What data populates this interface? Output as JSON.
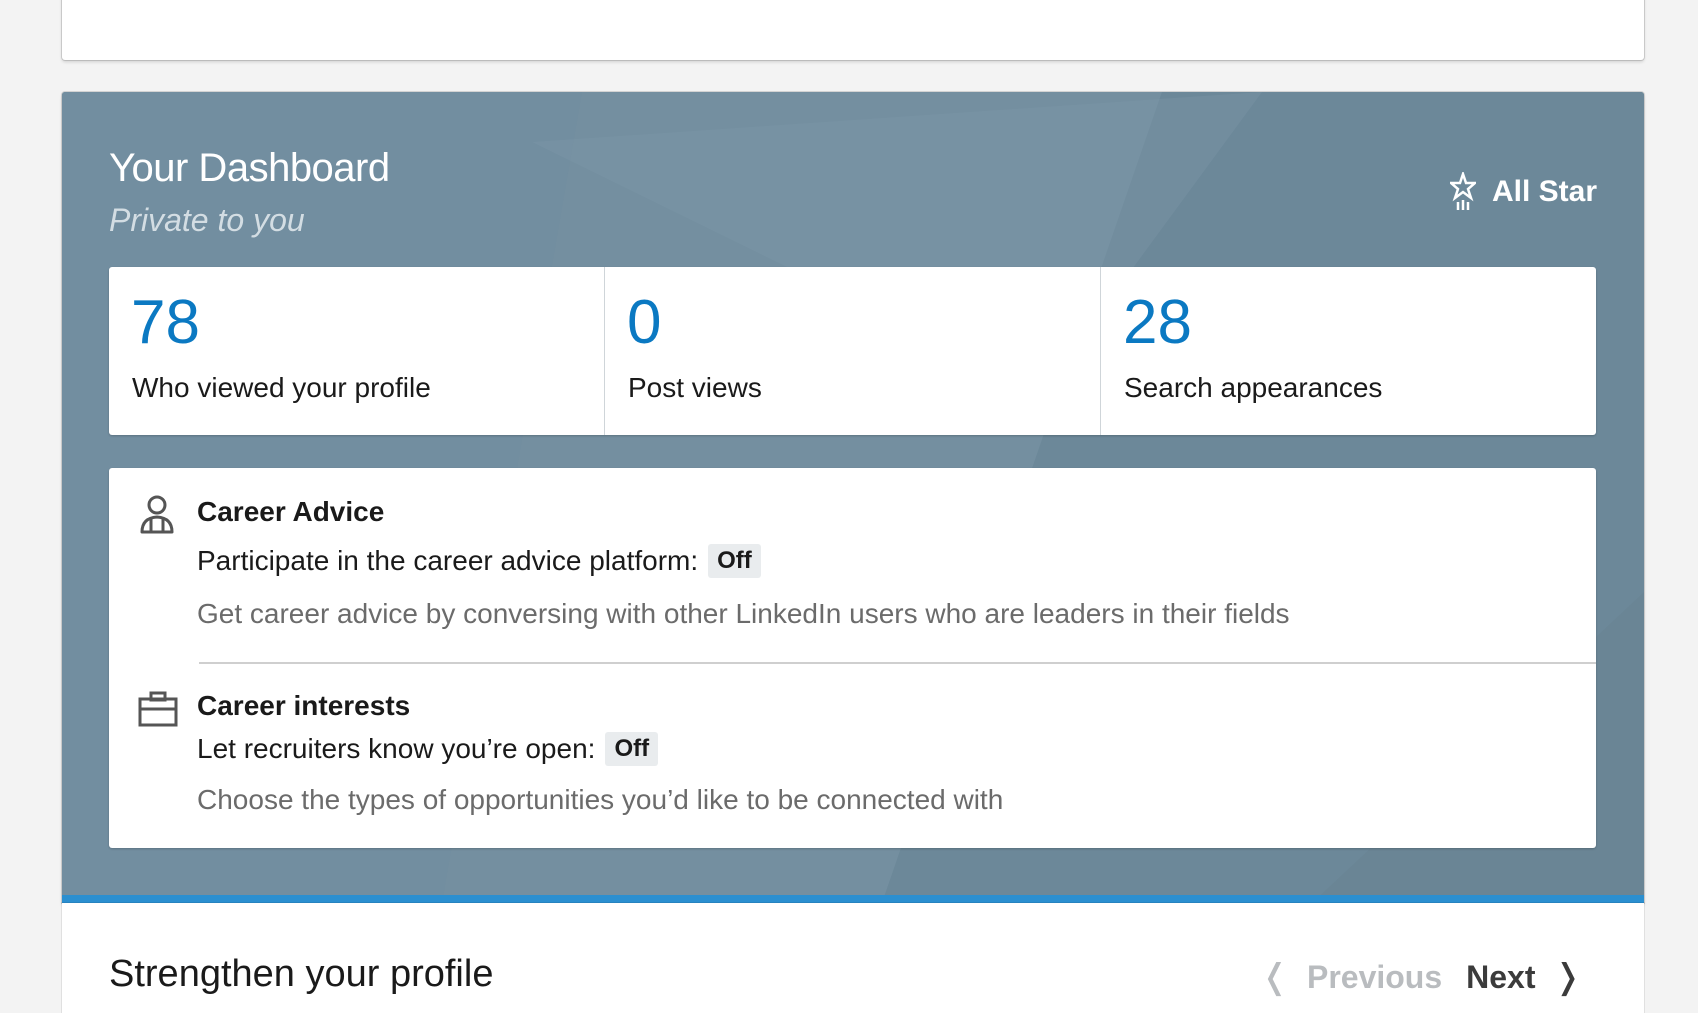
{
  "dashboard": {
    "title": "Your Dashboard",
    "subtitle": "Private to you",
    "level_label": "All Star",
    "stats": [
      {
        "value": "78",
        "label": "Who viewed your profile"
      },
      {
        "value": "0",
        "label": "Post views"
      },
      {
        "value": "28",
        "label": "Search appearances"
      }
    ],
    "career_advice": {
      "title": "Career Advice",
      "setting_label": "Participate in the career advice platform:",
      "status": "Off",
      "description": "Get career advice by conversing with other LinkedIn users who are leaders in their fields"
    },
    "career_interests": {
      "title": "Career interests",
      "setting_label": "Let recruiters know you’re open:",
      "status": "Off",
      "description": "Choose the types of opportunities you’d like to be connected with"
    }
  },
  "strengthen": {
    "heading": "Strengthen your profile",
    "previous_label": "Previous",
    "next_label": "Next"
  },
  "colors": {
    "dashboard_bg": "#6f8b9c",
    "accent": "#0b79c2",
    "bottom_bar": "#2b8fd0"
  }
}
